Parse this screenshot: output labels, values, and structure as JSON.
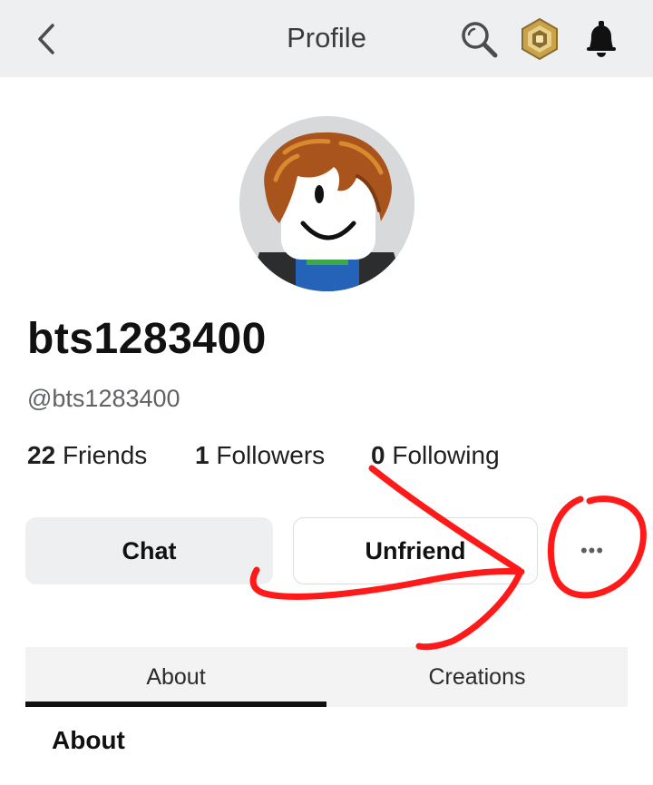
{
  "header": {
    "title": "Profile",
    "back_icon": "chevron-left-icon",
    "icons": [
      "search-icon",
      "robux-icon",
      "bell-icon"
    ]
  },
  "profile": {
    "display_name": "bts1283400",
    "username": "@bts1283400",
    "avatar": "avatar-headshot"
  },
  "stats": {
    "friends_count": "22",
    "friends_label": "Friends",
    "followers_count": "1",
    "followers_label": "Followers",
    "following_count": "0",
    "following_label": "Following"
  },
  "actions": {
    "chat_label": "Chat",
    "unfriend_label": "Unfriend",
    "more_label": "•••"
  },
  "tabs": [
    {
      "label": "About",
      "selected": true
    },
    {
      "label": "Creations",
      "selected": false
    }
  ],
  "section": {
    "heading": "About"
  },
  "colors": {
    "topbar_bg": "#eeeff1",
    "annotation_red": "#ff1a1a",
    "robux_gold": "#c9a24a"
  }
}
